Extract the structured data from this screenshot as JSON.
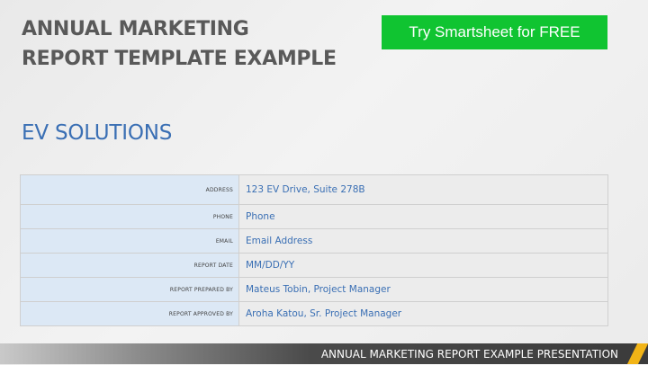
{
  "header": {
    "title_line1": "ANNUAL MARKETING",
    "title_line2": "REPORT TEMPLATE EXAMPLE",
    "cta_label": "Try Smartsheet for FREE"
  },
  "company": {
    "name": "EV SOLUTIONS"
  },
  "info_table": {
    "rows": [
      {
        "label": "ADDRESS",
        "value": "123 EV Drive, Suite 278B"
      },
      {
        "label": "PHONE",
        "value": "Phone"
      },
      {
        "label": "EMAIL",
        "value": "Email Address"
      },
      {
        "label": "REPORT DATE",
        "value": "MM/DD/YY"
      },
      {
        "label": "REPORT PREPARED BY",
        "value": "Mateus Tobin, Project Manager"
      },
      {
        "label": "REPORT APPROVED BY",
        "value": "Aroha Katou, Sr. Project Manager"
      }
    ]
  },
  "footer": {
    "text": "ANNUAL MARKETING REPORT EXAMPLE PRESENTATION"
  },
  "colors": {
    "cta_background": "#10c431",
    "accent_blue": "#3a6fb4",
    "label_cell_background": "#dce8f5",
    "footer_stripe": "#f2b416"
  }
}
